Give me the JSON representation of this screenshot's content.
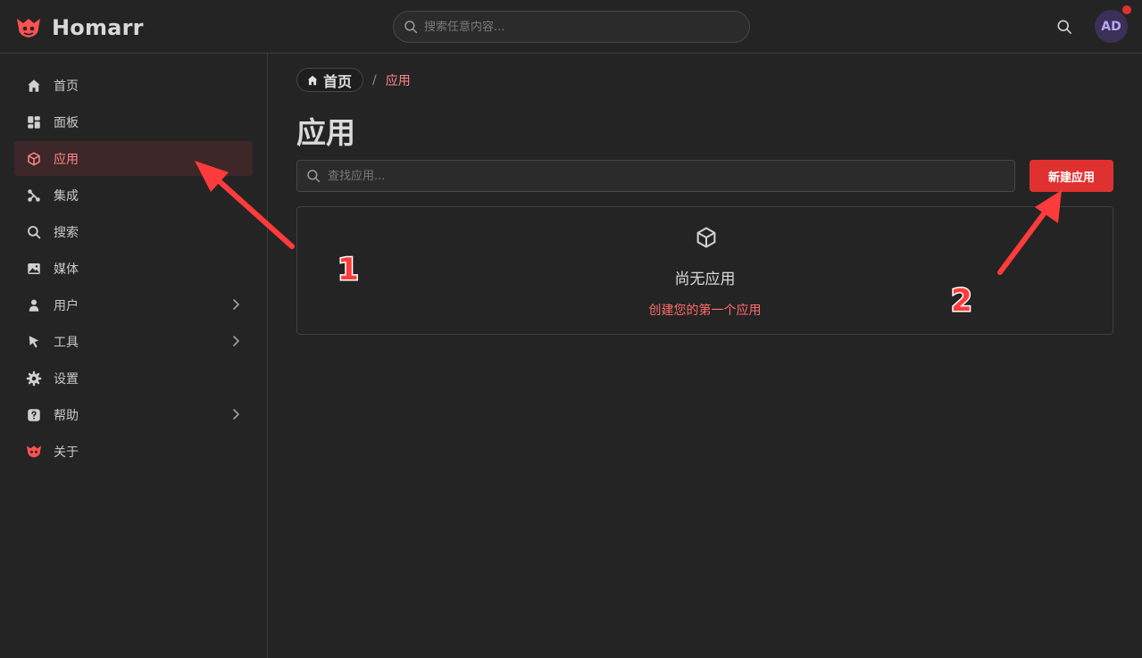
{
  "header": {
    "brand": "Homarr",
    "search_placeholder": "搜索任意内容...",
    "avatar_initials": "AD"
  },
  "sidebar": {
    "items": [
      {
        "label": "首页",
        "icon": "home-icon"
      },
      {
        "label": "面板",
        "icon": "layout-dashboard-icon"
      },
      {
        "label": "应用",
        "icon": "box-icon",
        "active": true
      },
      {
        "label": "集成",
        "icon": "plug-connected-icon"
      },
      {
        "label": "搜索",
        "icon": "search-icon"
      },
      {
        "label": "媒体",
        "icon": "photo-icon"
      },
      {
        "label": "用户",
        "icon": "user-icon",
        "has_children": true
      },
      {
        "label": "工具",
        "icon": "pointer-icon",
        "has_children": true
      },
      {
        "label": "设置",
        "icon": "settings-icon"
      },
      {
        "label": "帮助",
        "icon": "help-icon",
        "has_children": true
      },
      {
        "label": "关于",
        "icon": "homarr-logo-icon"
      }
    ]
  },
  "breadcrumb": {
    "home": "首页",
    "separator": "/",
    "current": "应用"
  },
  "main": {
    "title": "应用",
    "search_placeholder": "查找应用...",
    "new_button": "新建应用",
    "empty": {
      "title": "尚无应用",
      "link": "创建您的第一个应用"
    }
  },
  "annotations": {
    "label_1": "1",
    "label_2": "2"
  },
  "colors": {
    "accent": "#e03131",
    "accent_text": "#ff8787",
    "background": "#242424",
    "active_nav_bg": "#3d2729",
    "annotation": "#ff3b3b"
  }
}
